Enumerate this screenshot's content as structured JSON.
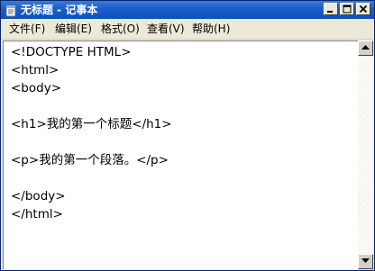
{
  "window": {
    "title": "无标题 - 记事本"
  },
  "menu": [
    {
      "label": "文件(F)"
    },
    {
      "label": "编辑(E)"
    },
    {
      "label": "格式(O)"
    },
    {
      "label": "查看(V)"
    },
    {
      "label": "帮助(H)"
    }
  ],
  "editor": {
    "content": "<!DOCTYPE HTML>\n<html>\n<body>\n\n<h1>我的第一个标题</h1>\n\n<p>我的第一个段落。</p>\n\n</body>\n</html>"
  },
  "icons": {
    "app": "notepad-icon",
    "minimize": "minimize-icon",
    "maximize": "maximize-icon",
    "close": "close-icon",
    "scroll_up": "arrow-up-icon",
    "scroll_down": "arrow-down-icon"
  },
  "colors": {
    "titlebar": "#1c5fcb",
    "title_text": "#ffffff",
    "editor_bg": "#ffffff"
  }
}
